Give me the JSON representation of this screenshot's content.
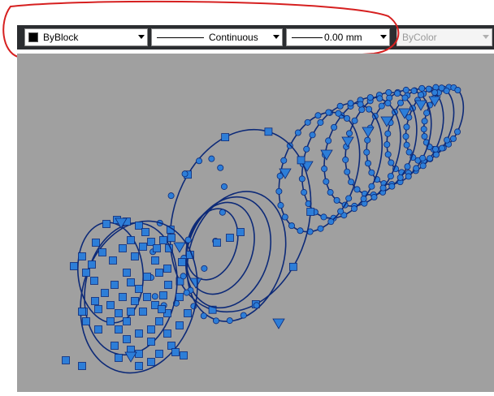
{
  "toolbar": {
    "color_value": "ByBlock",
    "linetype_value": "Continuous",
    "lineweight_value": "0.00 mm",
    "plotstyle_value": "ByColor"
  },
  "colors": {
    "canvas_background": "#a0a0a0",
    "grip_fill": "#2d7ed8",
    "curve_stroke": "#0d2a78",
    "annotation_stroke": "#d62020"
  },
  "icons": [
    "dropdown-chevron-icon",
    "color-swatch-icon"
  ]
}
